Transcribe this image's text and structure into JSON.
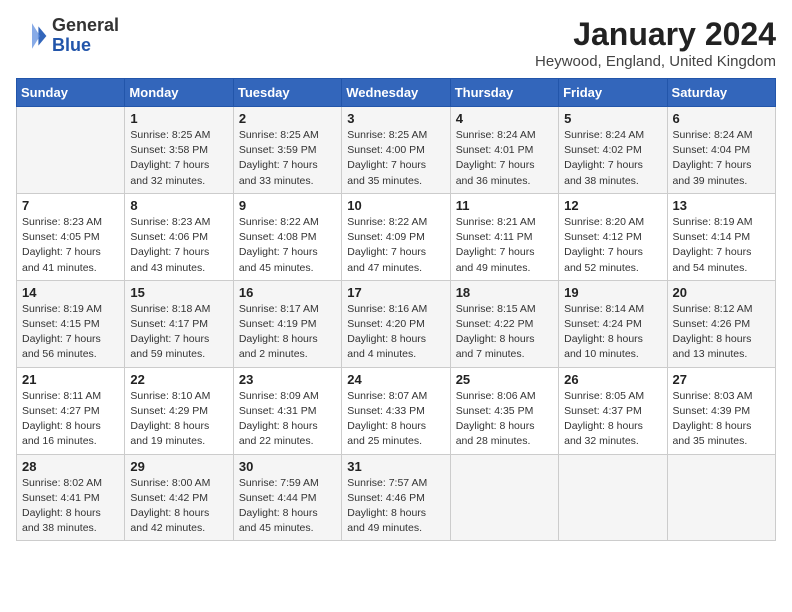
{
  "header": {
    "logo_general": "General",
    "logo_blue": "Blue",
    "month": "January 2024",
    "location": "Heywood, England, United Kingdom"
  },
  "days_of_week": [
    "Sunday",
    "Monday",
    "Tuesday",
    "Wednesday",
    "Thursday",
    "Friday",
    "Saturday"
  ],
  "weeks": [
    [
      {
        "day": "",
        "sunrise": "",
        "sunset": "",
        "daylight": ""
      },
      {
        "day": "1",
        "sunrise": "Sunrise: 8:25 AM",
        "sunset": "Sunset: 3:58 PM",
        "daylight": "Daylight: 7 hours and 32 minutes."
      },
      {
        "day": "2",
        "sunrise": "Sunrise: 8:25 AM",
        "sunset": "Sunset: 3:59 PM",
        "daylight": "Daylight: 7 hours and 33 minutes."
      },
      {
        "day": "3",
        "sunrise": "Sunrise: 8:25 AM",
        "sunset": "Sunset: 4:00 PM",
        "daylight": "Daylight: 7 hours and 35 minutes."
      },
      {
        "day": "4",
        "sunrise": "Sunrise: 8:24 AM",
        "sunset": "Sunset: 4:01 PM",
        "daylight": "Daylight: 7 hours and 36 minutes."
      },
      {
        "day": "5",
        "sunrise": "Sunrise: 8:24 AM",
        "sunset": "Sunset: 4:02 PM",
        "daylight": "Daylight: 7 hours and 38 minutes."
      },
      {
        "day": "6",
        "sunrise": "Sunrise: 8:24 AM",
        "sunset": "Sunset: 4:04 PM",
        "daylight": "Daylight: 7 hours and 39 minutes."
      }
    ],
    [
      {
        "day": "7",
        "sunrise": "Sunrise: 8:23 AM",
        "sunset": "Sunset: 4:05 PM",
        "daylight": "Daylight: 7 hours and 41 minutes."
      },
      {
        "day": "8",
        "sunrise": "Sunrise: 8:23 AM",
        "sunset": "Sunset: 4:06 PM",
        "daylight": "Daylight: 7 hours and 43 minutes."
      },
      {
        "day": "9",
        "sunrise": "Sunrise: 8:22 AM",
        "sunset": "Sunset: 4:08 PM",
        "daylight": "Daylight: 7 hours and 45 minutes."
      },
      {
        "day": "10",
        "sunrise": "Sunrise: 8:22 AM",
        "sunset": "Sunset: 4:09 PM",
        "daylight": "Daylight: 7 hours and 47 minutes."
      },
      {
        "day": "11",
        "sunrise": "Sunrise: 8:21 AM",
        "sunset": "Sunset: 4:11 PM",
        "daylight": "Daylight: 7 hours and 49 minutes."
      },
      {
        "day": "12",
        "sunrise": "Sunrise: 8:20 AM",
        "sunset": "Sunset: 4:12 PM",
        "daylight": "Daylight: 7 hours and 52 minutes."
      },
      {
        "day": "13",
        "sunrise": "Sunrise: 8:19 AM",
        "sunset": "Sunset: 4:14 PM",
        "daylight": "Daylight: 7 hours and 54 minutes."
      }
    ],
    [
      {
        "day": "14",
        "sunrise": "Sunrise: 8:19 AM",
        "sunset": "Sunset: 4:15 PM",
        "daylight": "Daylight: 7 hours and 56 minutes."
      },
      {
        "day": "15",
        "sunrise": "Sunrise: 8:18 AM",
        "sunset": "Sunset: 4:17 PM",
        "daylight": "Daylight: 7 hours and 59 minutes."
      },
      {
        "day": "16",
        "sunrise": "Sunrise: 8:17 AM",
        "sunset": "Sunset: 4:19 PM",
        "daylight": "Daylight: 8 hours and 2 minutes."
      },
      {
        "day": "17",
        "sunrise": "Sunrise: 8:16 AM",
        "sunset": "Sunset: 4:20 PM",
        "daylight": "Daylight: 8 hours and 4 minutes."
      },
      {
        "day": "18",
        "sunrise": "Sunrise: 8:15 AM",
        "sunset": "Sunset: 4:22 PM",
        "daylight": "Daylight: 8 hours and 7 minutes."
      },
      {
        "day": "19",
        "sunrise": "Sunrise: 8:14 AM",
        "sunset": "Sunset: 4:24 PM",
        "daylight": "Daylight: 8 hours and 10 minutes."
      },
      {
        "day": "20",
        "sunrise": "Sunrise: 8:12 AM",
        "sunset": "Sunset: 4:26 PM",
        "daylight": "Daylight: 8 hours and 13 minutes."
      }
    ],
    [
      {
        "day": "21",
        "sunrise": "Sunrise: 8:11 AM",
        "sunset": "Sunset: 4:27 PM",
        "daylight": "Daylight: 8 hours and 16 minutes."
      },
      {
        "day": "22",
        "sunrise": "Sunrise: 8:10 AM",
        "sunset": "Sunset: 4:29 PM",
        "daylight": "Daylight: 8 hours and 19 minutes."
      },
      {
        "day": "23",
        "sunrise": "Sunrise: 8:09 AM",
        "sunset": "Sunset: 4:31 PM",
        "daylight": "Daylight: 8 hours and 22 minutes."
      },
      {
        "day": "24",
        "sunrise": "Sunrise: 8:07 AM",
        "sunset": "Sunset: 4:33 PM",
        "daylight": "Daylight: 8 hours and 25 minutes."
      },
      {
        "day": "25",
        "sunrise": "Sunrise: 8:06 AM",
        "sunset": "Sunset: 4:35 PM",
        "daylight": "Daylight: 8 hours and 28 minutes."
      },
      {
        "day": "26",
        "sunrise": "Sunrise: 8:05 AM",
        "sunset": "Sunset: 4:37 PM",
        "daylight": "Daylight: 8 hours and 32 minutes."
      },
      {
        "day": "27",
        "sunrise": "Sunrise: 8:03 AM",
        "sunset": "Sunset: 4:39 PM",
        "daylight": "Daylight: 8 hours and 35 minutes."
      }
    ],
    [
      {
        "day": "28",
        "sunrise": "Sunrise: 8:02 AM",
        "sunset": "Sunset: 4:41 PM",
        "daylight": "Daylight: 8 hours and 38 minutes."
      },
      {
        "day": "29",
        "sunrise": "Sunrise: 8:00 AM",
        "sunset": "Sunset: 4:42 PM",
        "daylight": "Daylight: 8 hours and 42 minutes."
      },
      {
        "day": "30",
        "sunrise": "Sunrise: 7:59 AM",
        "sunset": "Sunset: 4:44 PM",
        "daylight": "Daylight: 8 hours and 45 minutes."
      },
      {
        "day": "31",
        "sunrise": "Sunrise: 7:57 AM",
        "sunset": "Sunset: 4:46 PM",
        "daylight": "Daylight: 8 hours and 49 minutes."
      },
      {
        "day": "",
        "sunrise": "",
        "sunset": "",
        "daylight": ""
      },
      {
        "day": "",
        "sunrise": "",
        "sunset": "",
        "daylight": ""
      },
      {
        "day": "",
        "sunrise": "",
        "sunset": "",
        "daylight": ""
      }
    ]
  ]
}
